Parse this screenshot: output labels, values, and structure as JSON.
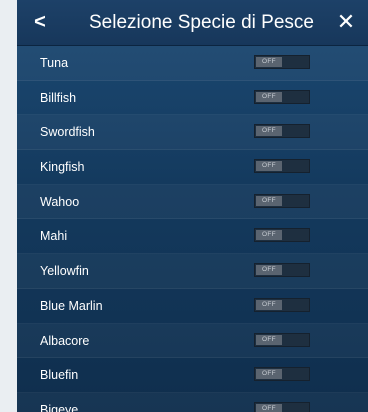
{
  "header": {
    "back_label": "<",
    "title": "Selezione Specie di Pesce",
    "close_label": "✕"
  },
  "species": [
    {
      "name": "Tuna",
      "state": "OFF"
    },
    {
      "name": "Billfish",
      "state": "OFF"
    },
    {
      "name": "Swordfish",
      "state": "OFF"
    },
    {
      "name": "Kingfish",
      "state": "OFF"
    },
    {
      "name": "Wahoo",
      "state": "OFF"
    },
    {
      "name": "Mahi",
      "state": "OFF"
    },
    {
      "name": "Yellowfin",
      "state": "OFF"
    },
    {
      "name": "Blue Marlin",
      "state": "OFF"
    },
    {
      "name": "Albacore",
      "state": "OFF"
    },
    {
      "name": "Bluefin",
      "state": "OFF"
    },
    {
      "name": "Bigeye",
      "state": "OFF"
    }
  ],
  "colors": {
    "background": "#143a5e",
    "header": "#1d4168",
    "toggle_off": "#5a6470"
  }
}
